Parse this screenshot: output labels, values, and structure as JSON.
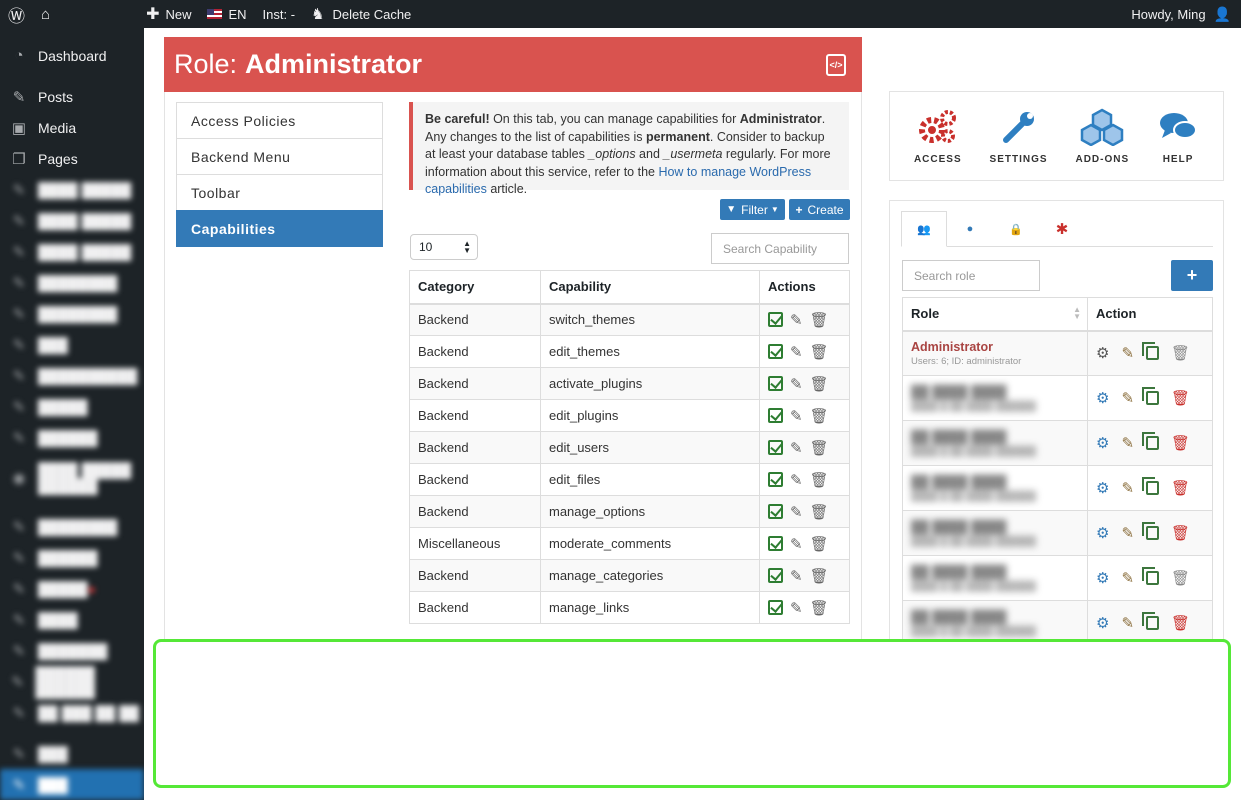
{
  "adminbar": {
    "new_label": "New",
    "lang_label": "EN",
    "inst_label": "Inst: -",
    "cache_label": "Delete Cache",
    "howdy": "Howdy, Ming"
  },
  "sidebar": {
    "items": [
      {
        "label": "Dashboard",
        "icon": "dashboard-icon"
      },
      {
        "label": "Posts",
        "icon": "pin-icon"
      },
      {
        "label": "Media",
        "icon": "media-icon"
      },
      {
        "label": "Pages",
        "icon": "pages-icon"
      }
    ]
  },
  "header": {
    "prefix": "Role:",
    "role": "Administrator"
  },
  "tabs": [
    "Access Policies",
    "Backend Menu",
    "Toolbar",
    "Capabilities"
  ],
  "notice": {
    "strong": "Be careful!",
    "t1": " On this tab, you can manage capabilities for ",
    "role": "Administrator",
    "t2": ". Any changes to the list of capabilities is ",
    "perm": "permanent",
    "t3": ". Consider to backup at least your database tables ",
    "opt": "_options",
    "t4": " and ",
    "um": "_usermeta",
    "t5": " regularly. For more information about this service, refer to the ",
    "link": "How to manage WordPress capabilities",
    "t6": " article."
  },
  "toolbar": {
    "filter": "Filter",
    "create": "Create",
    "perpage": "10",
    "search_placeholder": "Search Capability"
  },
  "cap_table": {
    "headers": [
      "Category",
      "Capability",
      "Actions"
    ],
    "rows": [
      [
        "Backend",
        "switch_themes"
      ],
      [
        "Backend",
        "edit_themes"
      ],
      [
        "Backend",
        "activate_plugins"
      ],
      [
        "Backend",
        "edit_plugins"
      ],
      [
        "Backend",
        "edit_users"
      ],
      [
        "Backend",
        "edit_files"
      ],
      [
        "Backend",
        "manage_options"
      ],
      [
        "Miscellaneous",
        "moderate_comments"
      ],
      [
        "Backend",
        "manage_categories"
      ],
      [
        "Backend",
        "manage_links"
      ]
    ]
  },
  "features": [
    {
      "label": "ACCESS",
      "icon": "gears-icon"
    },
    {
      "label": "SETTINGS",
      "icon": "wrench-icon"
    },
    {
      "label": "ADD-ONS",
      "icon": "cubes-icon"
    },
    {
      "label": "HELP",
      "icon": "chat-icon"
    }
  ],
  "roles": {
    "search_placeholder": "Search role",
    "headers": [
      "Role",
      "Action"
    ],
    "first": {
      "name": "Administrator",
      "sub": "Users: 6; ID: administrator"
    }
  },
  "colors": {
    "header_red": "#d9534f",
    "primary": "#337ab7",
    "highlight": "#55e837"
  }
}
